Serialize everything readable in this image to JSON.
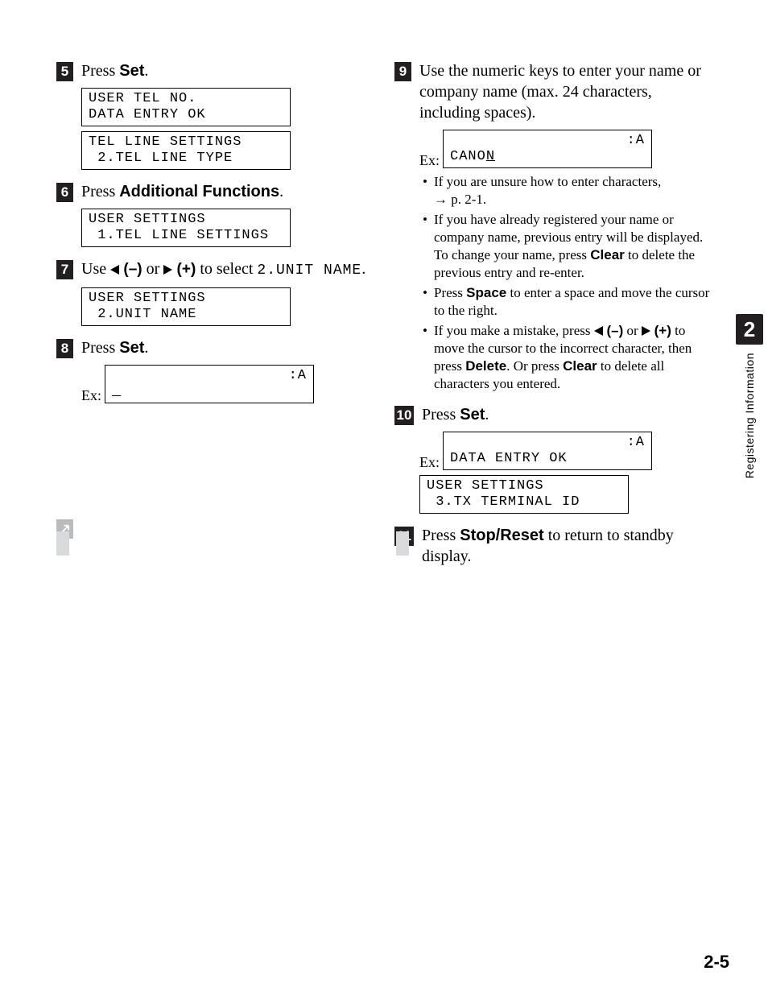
{
  "left": {
    "step5": {
      "num": "5",
      "pre": "Press ",
      "bold": "Set",
      "post": ".",
      "lcd1a": "USER TEL NO.",
      "lcd1b": "DATA ENTRY OK",
      "lcd2a": "TEL LINE SETTINGS",
      "lcd2b": " 2.TEL LINE TYPE"
    },
    "step6": {
      "num": "6",
      "pre": "Press ",
      "bold": "Additional Functions",
      "post": ".",
      "lcd1a": "USER SETTINGS",
      "lcd1b": " 1.TEL LINE SETTINGS"
    },
    "step7": {
      "num": "7",
      "pre": "Use ",
      "minus": " (–)",
      "mid": " or ",
      "plus": " (+)",
      "post1": " to select ",
      "mono": "2.UNIT NAME",
      "post2": ".",
      "lcd1a": "USER SETTINGS",
      "lcd1b": " 2.UNIT NAME"
    },
    "step8": {
      "num": "8",
      "pre": "Press ",
      "bold": "Set",
      "post": ".",
      "ex": "Ex:",
      "a": ":A",
      "cursor": "_"
    }
  },
  "right": {
    "step9": {
      "num": "9",
      "text": "Use the numeric keys to enter your name or company name (max. 24 characters, including spaces).",
      "ex": "Ex:",
      "a": ":A",
      "lcd_value_prefix": "CANO",
      "lcd_value_cursor": "N",
      "b1a": "If you are unsure how to enter characters,",
      "b1b": "p. 2-1.",
      "b2a": "If you have already registered your name or company name, previous entry will be displayed. To change your name, press ",
      "b2_bold": "Clear",
      "b2b": " to delete the previous entry and re-enter.",
      "b3a": "Press ",
      "b3_bold": "Space",
      "b3b": " to enter a space and move the cursor to the right.",
      "b4a": "If you make a mistake, press ",
      "b4_minus": " (–)",
      "b4_mid": " or ",
      "b4_plus": " (+)",
      "b4b": " to move the cursor to the incorrect character, then press ",
      "b4_bold1": "Delete",
      "b4c": ". Or press ",
      "b4_bold2": "Clear",
      "b4d": " to delete all characters you entered."
    },
    "step10": {
      "num": "10",
      "pre": "Press ",
      "bold": "Set",
      "post": ".",
      "ex": "Ex:",
      "a": ":A",
      "lcd1_line2": "DATA ENTRY OK",
      "lcd2a": "USER SETTINGS",
      "lcd2b": " 3.TX TERMINAL ID"
    },
    "step11": {
      "num": "11",
      "pre": "Press ",
      "bold": "Stop/Reset",
      "post": " to return to standby display."
    }
  },
  "tab": {
    "num": "2",
    "label": "Registering Information"
  },
  "page": "2-5"
}
